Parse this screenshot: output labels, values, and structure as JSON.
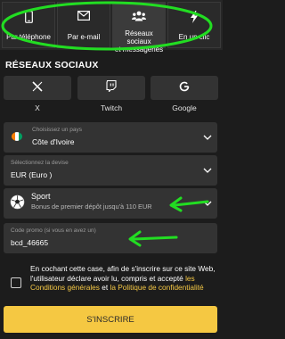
{
  "tabs": [
    {
      "label": "Par téléphone",
      "icon": "phone-icon"
    },
    {
      "label": "Par e-mail",
      "icon": "envelope-icon"
    },
    {
      "label_line1": "Réseaux sociaux",
      "label_line2": "et messageries",
      "icon": "people-icon",
      "active": true
    },
    {
      "label": "En un clic",
      "icon": "lightning-icon"
    }
  ],
  "section_title": "RÉSEAUX SOCIAUX",
  "social": [
    {
      "label": "X",
      "icon": "x-logo-icon"
    },
    {
      "label": "Twitch",
      "icon": "twitch-logo-icon"
    },
    {
      "label": "Google",
      "icon": "google-logo-icon"
    }
  ],
  "country": {
    "small_label": "Choisissez un pays",
    "value": "Côte d'Ivoire"
  },
  "currency": {
    "small_label": "Sélectionnez la devise",
    "value": "EUR  (Euro )"
  },
  "bonus": {
    "title": "Sport",
    "desc": "Bonus de premier dépôt jusqu'à 110 EUR"
  },
  "promo": {
    "small_label": "Code promo (si vous en avez un)",
    "value": "bcd_46665"
  },
  "consent": {
    "text": "En cochant cette case, afin de s'inscrire sur ce site Web, l'utilisateur déclare avoir lu, compris et accepté ",
    "link1": "les Conditions générales",
    "middle": " et ",
    "link2": "la Politique de confidentialité"
  },
  "submit_label": "S'INSCRIRE",
  "colors": {
    "accent": "#f5c842",
    "annotation": "#22dd22",
    "background": "#1c1c1c",
    "field": "#333333"
  }
}
